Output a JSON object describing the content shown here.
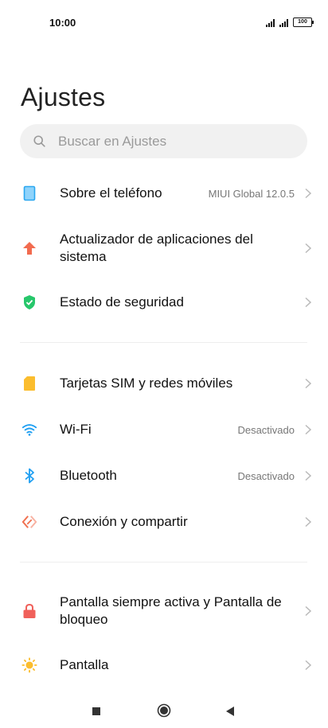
{
  "status_bar": {
    "time": "10:00",
    "battery": "100"
  },
  "header": {
    "title": "Ajustes"
  },
  "search": {
    "placeholder": "Buscar en Ajustes"
  },
  "items": [
    {
      "label": "Sobre el teléfono",
      "value": "MIUI Global 12.0.5",
      "icon": "phone-icon"
    },
    {
      "label": "Actualizador de aplicaciones del sistema",
      "value": "",
      "icon": "arrow-up-icon"
    },
    {
      "label": "Estado de seguridad",
      "value": "",
      "icon": "shield-icon"
    },
    {
      "label": "Tarjetas SIM y redes móviles",
      "value": "",
      "icon": "sim-card-icon"
    },
    {
      "label": "Wi-Fi",
      "value": "Desactivado",
      "icon": "wifi-icon"
    },
    {
      "label": "Bluetooth",
      "value": "Desactivado",
      "icon": "bluetooth-icon"
    },
    {
      "label": "Conexión y compartir",
      "value": "",
      "icon": "connection-icon"
    },
    {
      "label": "Pantalla siempre activa y Pantalla de bloqueo",
      "value": "",
      "icon": "lock-icon"
    },
    {
      "label": "Pantalla",
      "value": "",
      "icon": "sun-icon"
    }
  ],
  "colors": {
    "phone": "#2aa7f0",
    "update": "#f26b4f",
    "security": "#27c76b",
    "sim": "#fbbd2e",
    "wifi": "#1e9ff2",
    "bluetooth": "#1e9ff2",
    "connection": "#f0704f",
    "lock": "#f0605a",
    "display": "#fbbd2e"
  }
}
